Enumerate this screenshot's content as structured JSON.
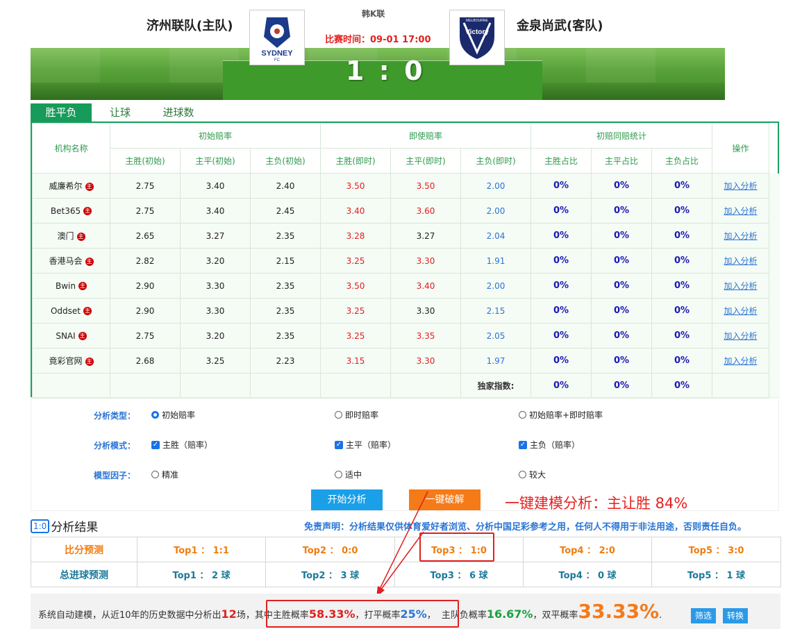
{
  "header": {
    "home_team": "济州联队(主队)",
    "away_team": "金泉尚武(客队)",
    "league": "韩K联",
    "match_time": "比赛时间：09-01 17:00",
    "score": "1 : 0",
    "home_logo_text": "SYDNEY",
    "home_logo_sub": "FC",
    "away_logo_text": "Victory",
    "away_logo_sub": "MELBOURNE"
  },
  "tabs": [
    "胜平负",
    "让球",
    "进球数"
  ],
  "odds": {
    "groups": [
      "机构名称",
      "初始赔率",
      "即使赔率",
      "初赔同赔统计",
      "操作"
    ],
    "subheaders": [
      "主胜(初始)",
      "主平(初始)",
      "主负(初始)",
      "主胜(即时)",
      "主平(即时)",
      "主负(即时)",
      "主胜占比",
      "主平占比",
      "主负占比"
    ],
    "badge": "主",
    "action_label": "加入分析",
    "rows": [
      {
        "name": "威廉希尔",
        "i": [
          "2.75",
          "3.40",
          "2.40"
        ],
        "n": [
          "3.50",
          "3.50",
          "2.00"
        ],
        "p": [
          "0%",
          "0%",
          "0%"
        ]
      },
      {
        "name": "Bet365",
        "i": [
          "2.75",
          "3.40",
          "2.45"
        ],
        "n": [
          "3.40",
          "3.60",
          "2.00"
        ],
        "p": [
          "0%",
          "0%",
          "0%"
        ]
      },
      {
        "name": "澳门",
        "i": [
          "2.65",
          "3.27",
          "2.35"
        ],
        "n": [
          "3.28",
          "3.27",
          "2.04"
        ],
        "p": [
          "0%",
          "0%",
          "0%"
        ]
      },
      {
        "name": "香港马会",
        "i": [
          "2.82",
          "3.20",
          "2.15"
        ],
        "n": [
          "3.25",
          "3.30",
          "1.91"
        ],
        "p": [
          "0%",
          "0%",
          "0%"
        ]
      },
      {
        "name": "Bwin",
        "i": [
          "2.90",
          "3.30",
          "2.35"
        ],
        "n": [
          "3.50",
          "3.40",
          "2.00"
        ],
        "p": [
          "0%",
          "0%",
          "0%"
        ]
      },
      {
        "name": "Oddset",
        "i": [
          "2.90",
          "3.30",
          "2.35"
        ],
        "n": [
          "3.25",
          "3.30",
          "2.15"
        ],
        "p": [
          "0%",
          "0%",
          "0%"
        ]
      },
      {
        "name": "SNAI",
        "i": [
          "2.75",
          "3.20",
          "2.35"
        ],
        "n": [
          "3.25",
          "3.35",
          "2.05"
        ],
        "p": [
          "0%",
          "0%",
          "0%"
        ]
      },
      {
        "name": "竟彩官网",
        "i": [
          "2.68",
          "3.25",
          "2.23"
        ],
        "n": [
          "3.15",
          "3.30",
          "1.97"
        ],
        "p": [
          "0%",
          "0%",
          "0%"
        ]
      }
    ],
    "exclusive_label": "独家指数:",
    "exclusive": [
      "0%",
      "0%",
      "0%"
    ]
  },
  "analysis": {
    "type_label": "分析类型：",
    "type_opts": [
      "初始赔率",
      "即时赔率",
      "初始赔率+即时赔率"
    ],
    "mode_label": "分析模式：",
    "mode_opts": [
      "主胜（赔率）",
      "主平（赔率）",
      "主负（赔率）"
    ],
    "factor_label": "模型因子：",
    "factor_opts": [
      "精准",
      "适中",
      "较大"
    ],
    "start_btn": "开始分析",
    "crack_btn": "一键破解",
    "annotation": "一键建模分析：主让胜 84%"
  },
  "results": {
    "badge": "1:0",
    "title": "分析结果",
    "disclaimer": "免责声明：分析结果仅供体育爱好者浏览、分析中国足彩参考之用，任何人不得用于非法用途，否则责任自负。",
    "score_label": "比分预测",
    "scores": [
      "Top1 ： 1:1",
      "Top2 ： 0:0",
      "Top3 ： 1:0",
      "Top4 ： 2:0",
      "Top5 ： 3:0"
    ],
    "goals_label": "总进球预测",
    "goals": [
      "Top1 ： 2 球",
      "Top2 ： 3 球",
      "Top3 ： 6 球",
      "Top4 ： 0 球",
      "Top5 ： 1 球"
    ]
  },
  "summary": {
    "p1": "系统自动建模，从近10年的历史数据中分析出",
    "count": "12",
    "p2": "场，",
    "p3": "其中主胜概率",
    "home_pct": "58.33%",
    "p4": "，打平概率",
    "draw_pct": "25%",
    "p5": "，",
    "p6": "主队负概率",
    "away_pct": "16.67%",
    "p7": "，双平概率",
    "double_pct": "33.33%",
    "p8": ".",
    "filter_btn": "筛选",
    "switch_btn": "转换"
  },
  "colors": {
    "green": "#179b5a",
    "red": "#e02020",
    "blue": "#2a75d5",
    "navy": "#1a1ab5",
    "orange": "#f57a18"
  }
}
